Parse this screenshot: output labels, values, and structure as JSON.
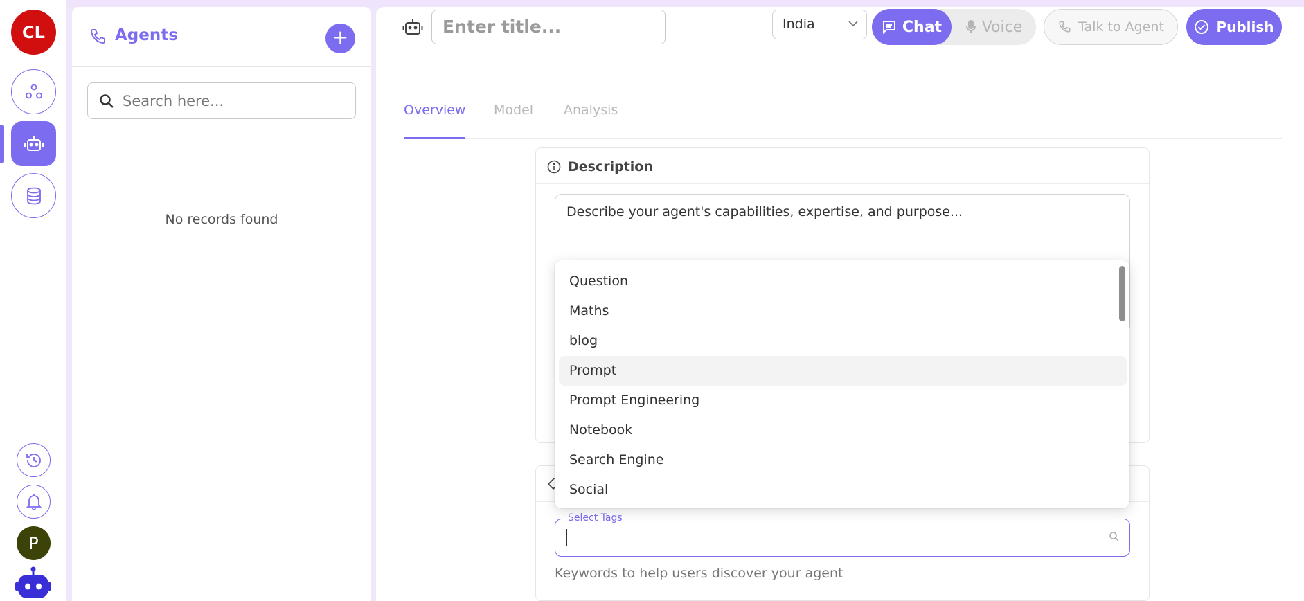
{
  "rail": {
    "org_initials": "CL",
    "user_initial": "P",
    "items": [
      {
        "name": "groups-icon"
      },
      {
        "name": "robot-icon",
        "active": true
      },
      {
        "name": "database-icon"
      }
    ],
    "bottom": [
      "history-icon",
      "bell-icon"
    ]
  },
  "agents": {
    "title": "Agents",
    "add_label": "+",
    "search_placeholder": "Search here...",
    "empty_text": "No records found"
  },
  "header": {
    "title_placeholder": "Enter title...",
    "country": "India",
    "chat_label": "Chat",
    "voice_label": "Voice",
    "talk_label": "Talk to Agent",
    "publish_label": "Publish"
  },
  "tabs": [
    {
      "label": "Overview",
      "active": true
    },
    {
      "label": "Model"
    },
    {
      "label": "Analysis"
    }
  ],
  "description": {
    "title": "Description",
    "placeholder": "Describe your agent's capabilities, expertise, and purpose..."
  },
  "tags": {
    "field_label": "Select Tags",
    "hint": "Keywords to help users discover your agent"
  },
  "dropdown": {
    "options": [
      "Question",
      "Maths",
      "blog",
      "Prompt",
      "Prompt Engineering",
      "Notebook",
      "Search Engine",
      "Social"
    ],
    "hovered": "Prompt"
  },
  "colors": {
    "accent": "#7b6cf0",
    "org_badge": "#d10f0f",
    "avatar": "#3d4208"
  }
}
